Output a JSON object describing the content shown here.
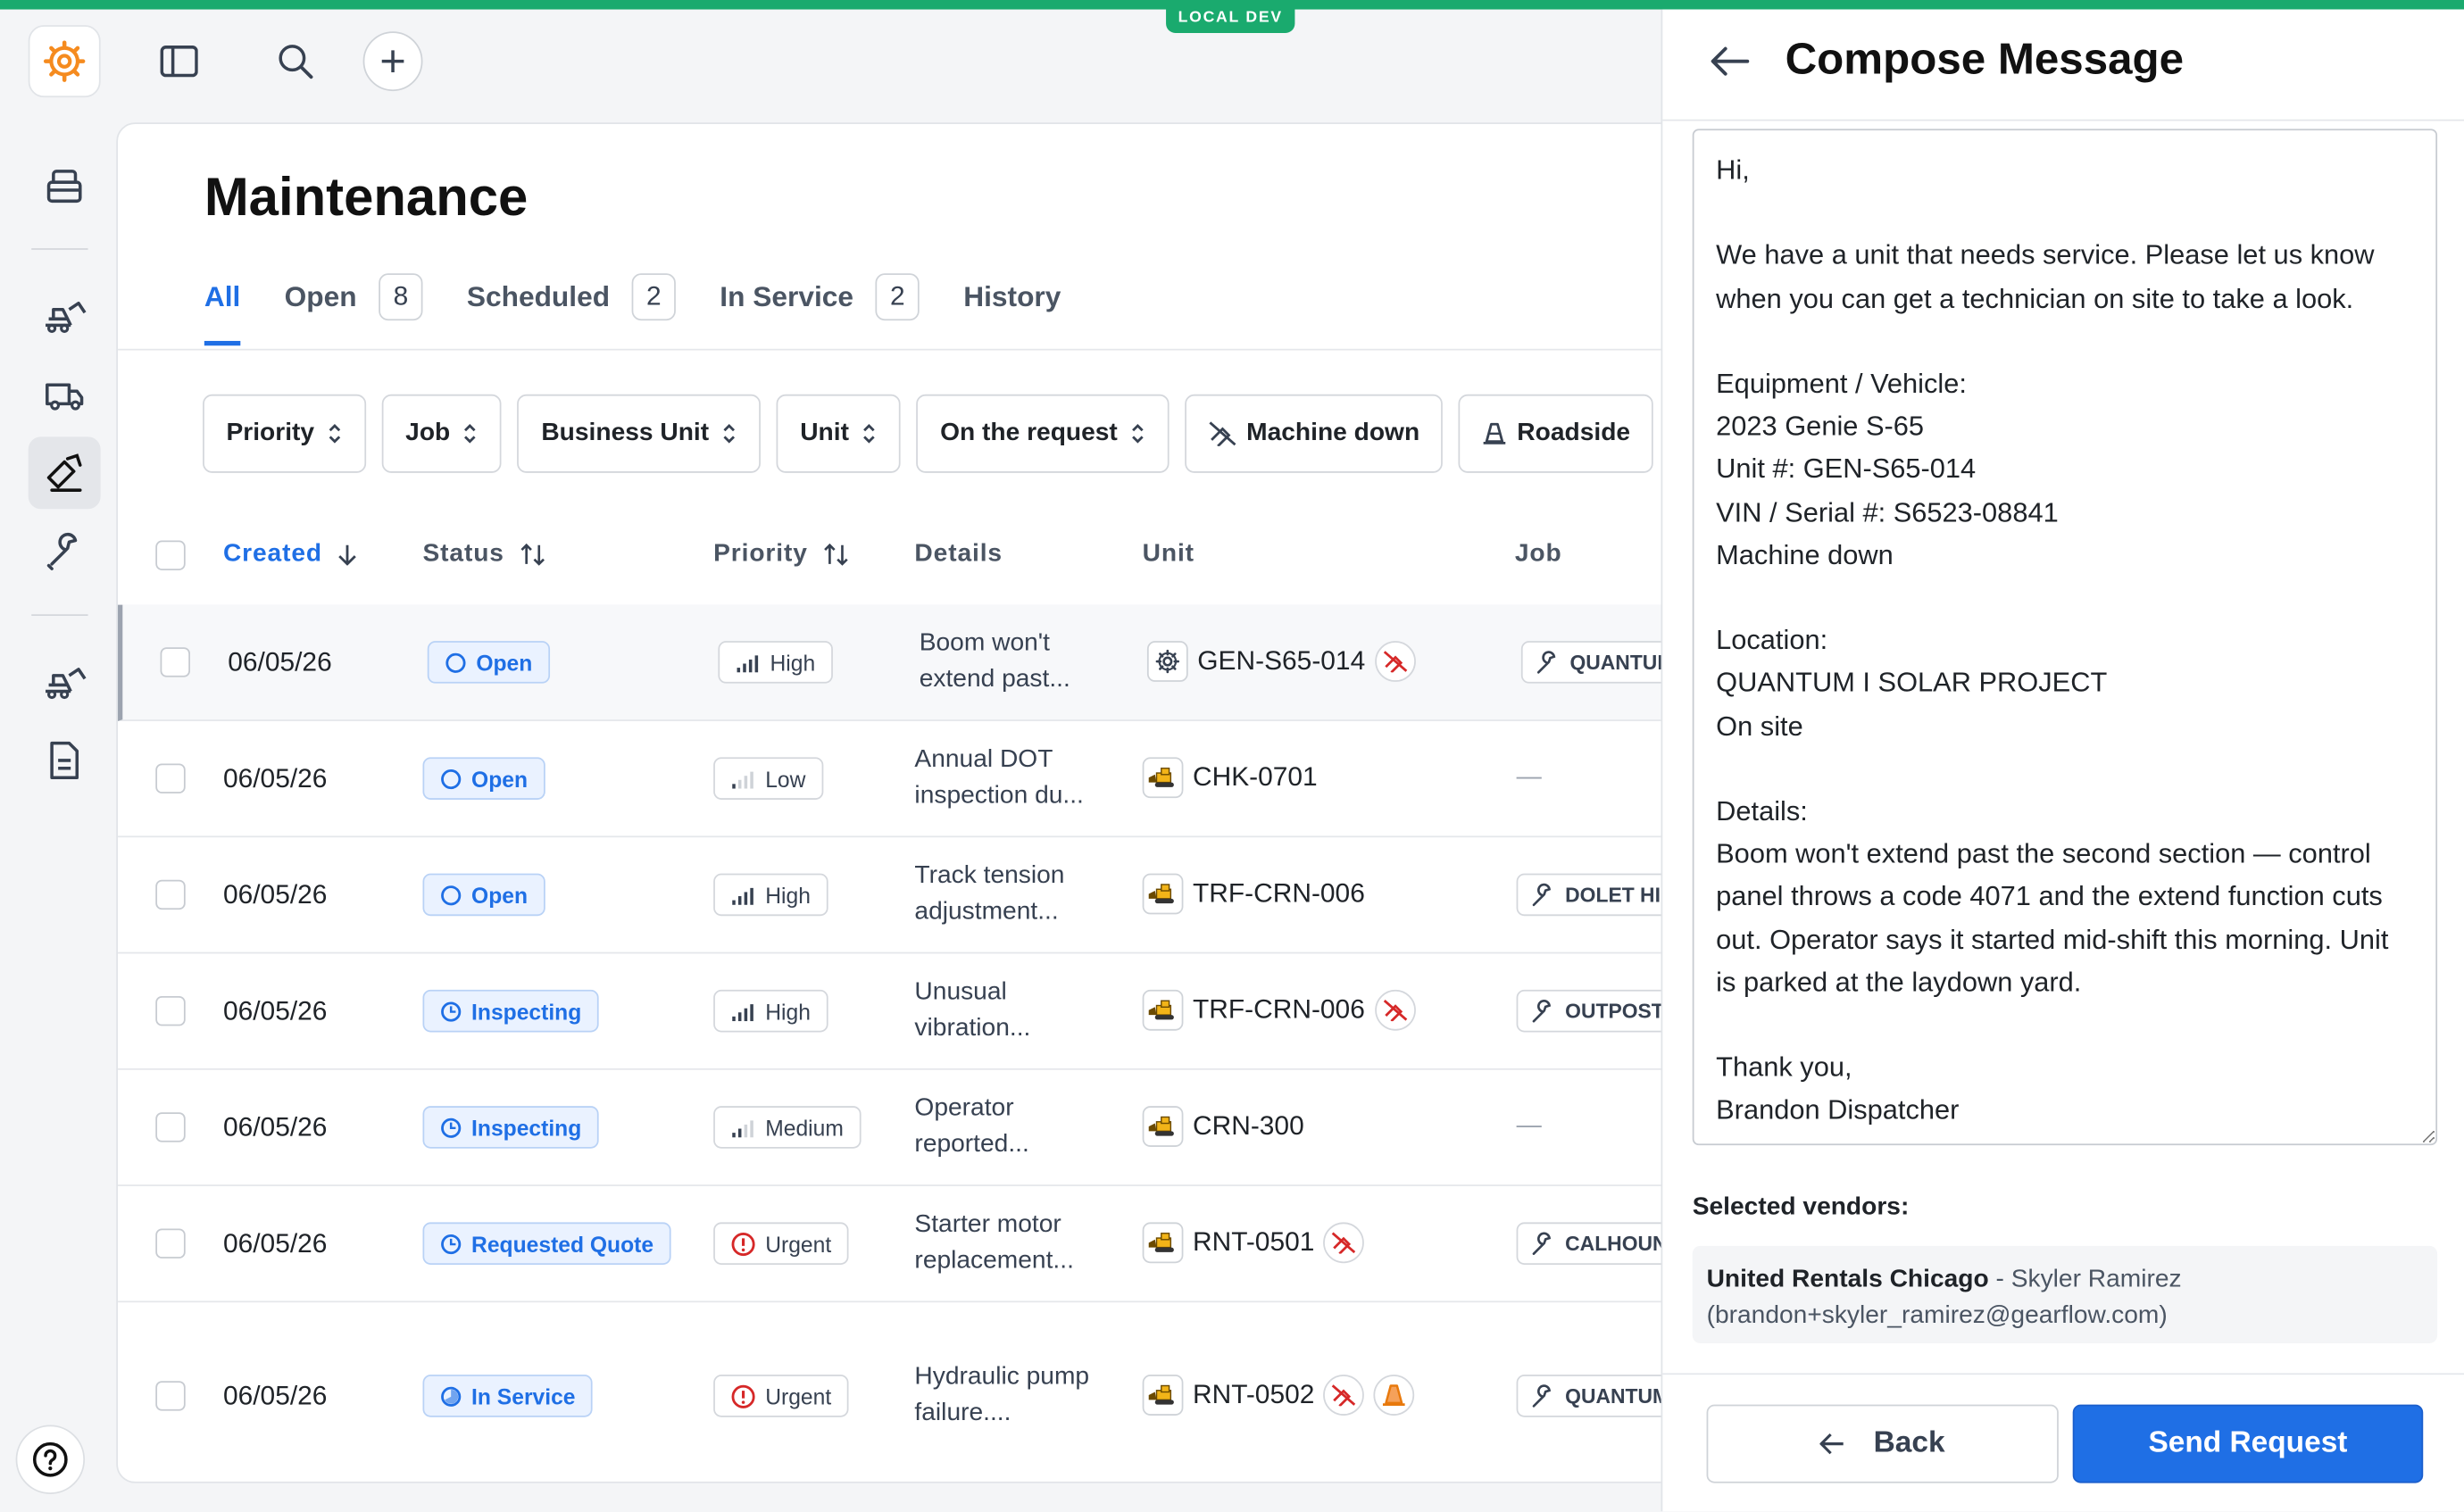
{
  "env_badge": "LOCAL DEV",
  "page": {
    "title": "Maintenance"
  },
  "tabs": [
    {
      "label": "All",
      "active": true
    },
    {
      "label": "Open",
      "count": "8"
    },
    {
      "label": "Scheduled",
      "count": "2"
    },
    {
      "label": "In Service",
      "count": "2"
    },
    {
      "label": "History"
    }
  ],
  "filters": {
    "priority": "Priority",
    "job": "Job",
    "business_unit": "Business Unit",
    "unit": "Unit",
    "on_request": "On the request",
    "machine_down": "Machine down",
    "roadside": "Roadside"
  },
  "columns": {
    "created": "Created",
    "status": "Status",
    "priority": "Priority",
    "details": "Details",
    "unit": "Unit",
    "job": "Job"
  },
  "rows": [
    {
      "date": "06/05/26",
      "status": "Open",
      "priority": "High",
      "details": "Boom won't extend past...",
      "unit": "GEN-S65-014",
      "job": "QUANTUM"
    },
    {
      "date": "06/05/26",
      "status": "Open",
      "priority": "Low",
      "details": "Annual DOT inspection du...",
      "unit": "CHK-0701",
      "job": "—"
    },
    {
      "date": "06/05/26",
      "status": "Open",
      "priority": "High",
      "details": "Track tension adjustment...",
      "unit": "TRF-CRN-006",
      "job": "DOLET HI"
    },
    {
      "date": "06/05/26",
      "status": "Inspecting",
      "priority": "High",
      "details": "Unusual vibration...",
      "unit": "TRF-CRN-006",
      "job": "OUTPOST"
    },
    {
      "date": "06/05/26",
      "status": "Inspecting",
      "priority": "Medium",
      "details": "Operator reported...",
      "unit": "CRN-300",
      "job": "—"
    },
    {
      "date": "06/05/26",
      "status": "Requested Quote",
      "priority": "Urgent",
      "details": "Starter motor replacement...",
      "unit": "RNT-0501",
      "job": "CALHOUN"
    },
    {
      "date": "06/05/26",
      "status": "In Service",
      "priority": "Urgent",
      "details": "Hydraulic pump failure....",
      "unit": "RNT-0502",
      "job": "QUANTUM"
    }
  ],
  "compose": {
    "title": "Compose Message",
    "body": "Hi,\n\nWe have a unit that needs service. Please let us know when you can get a technician on site to take a look.\n\nEquipment / Vehicle:\n2023 Genie S-65\nUnit #: GEN-S65-014\nVIN / Serial #: S6523-08841\nMachine down\n\nLocation:\nQUANTUM I SOLAR PROJECT\nOn site\n\nDetails:\nBoom won't extend past the second section — control panel throws a code 4071 and the extend function cuts out. Operator says it started mid-shift this morning. Unit is parked at the laydown yard.\n\nThank you,\nBrandon Dispatcher",
    "vendors_label": "Selected vendors:",
    "vendor_name": "United Rentals Chicago",
    "vendor_contact": " - Skyler Ramirez (brandon+skyler_ramirez@gearflow.com)",
    "back_label": "Back",
    "send_label": "Send Request"
  },
  "colors": {
    "accent": "#1f6fe5",
    "brand": "#1aaa6e",
    "danger": "#d62828",
    "warning": "#e8790c"
  }
}
